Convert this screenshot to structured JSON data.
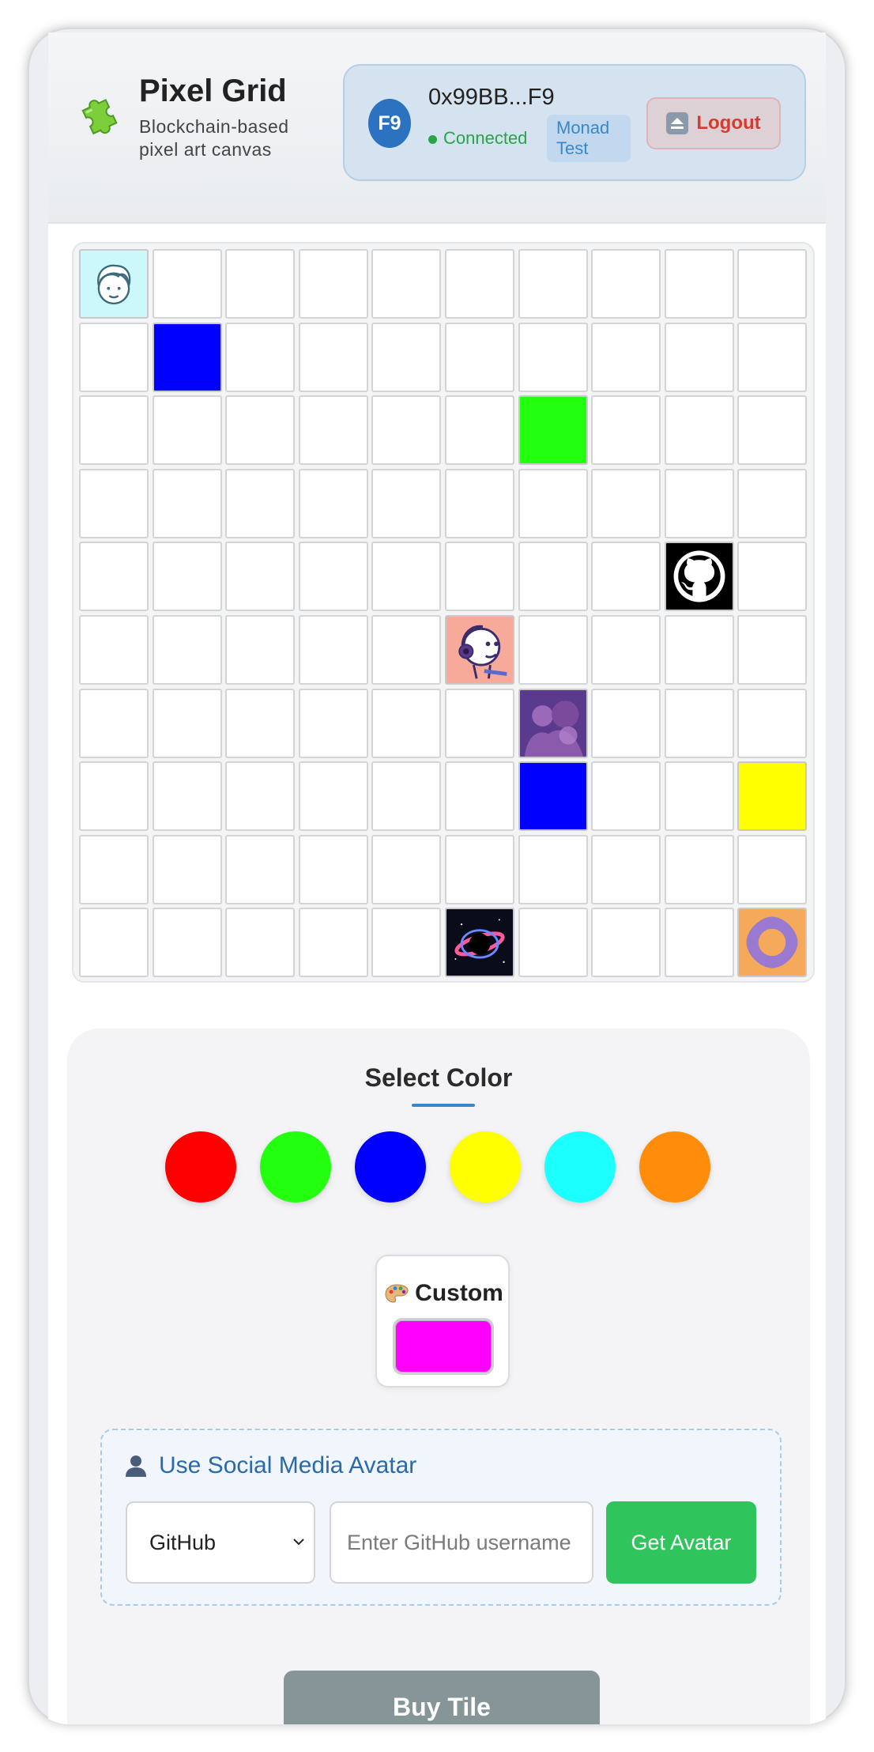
{
  "header": {
    "title": "Pixel Grid",
    "subtitle": "Blockchain-based pixel art canvas",
    "logo_icon": "puzzle-piece-icon"
  },
  "wallet": {
    "avatar_text": "F9",
    "address": "0x99BB...F9",
    "status": "Connected",
    "network": "Monad Test",
    "logout_label": "Logout",
    "status_color": "#27a548"
  },
  "grid": {
    "size": 10,
    "tiles": [
      {
        "row": 0,
        "col": 0,
        "kind": "avatar",
        "icon": "boy-face-avatar"
      },
      {
        "row": 1,
        "col": 1,
        "kind": "color",
        "color": "#0000ff"
      },
      {
        "row": 2,
        "col": 6,
        "kind": "color",
        "color": "#22ff0f"
      },
      {
        "row": 4,
        "col": 8,
        "kind": "avatar",
        "icon": "github-octocat-avatar"
      },
      {
        "row": 5,
        "col": 5,
        "kind": "avatar",
        "icon": "headphones-cartoon-avatar"
      },
      {
        "row": 6,
        "col": 6,
        "kind": "avatar",
        "icon": "purple-photo-avatar"
      },
      {
        "row": 7,
        "col": 6,
        "kind": "color",
        "color": "#0000ff"
      },
      {
        "row": 7,
        "col": 9,
        "kind": "color",
        "color": "#ffff00"
      },
      {
        "row": 9,
        "col": 5,
        "kind": "avatar",
        "icon": "black-hole-avatar"
      },
      {
        "row": 9,
        "col": 9,
        "kind": "avatar",
        "icon": "orange-diamond-avatar"
      }
    ]
  },
  "color_picker": {
    "title": "Select Color",
    "swatches": [
      "#ff0000",
      "#22ff0f",
      "#0000ff",
      "#ffff00",
      "#1cffff",
      "#ff8c0a"
    ],
    "custom_label": "Custom",
    "custom_icon": "palette-icon",
    "custom_color": "#ff00ff"
  },
  "social": {
    "title": "Use Social Media Avatar",
    "title_icon": "user-silhouette-icon",
    "platform": "GitHub",
    "username_placeholder": "Enter GitHub username",
    "username_value": "",
    "get_avatar_label": "Get Avatar"
  },
  "actions": {
    "buy_label": "Buy Tile"
  }
}
